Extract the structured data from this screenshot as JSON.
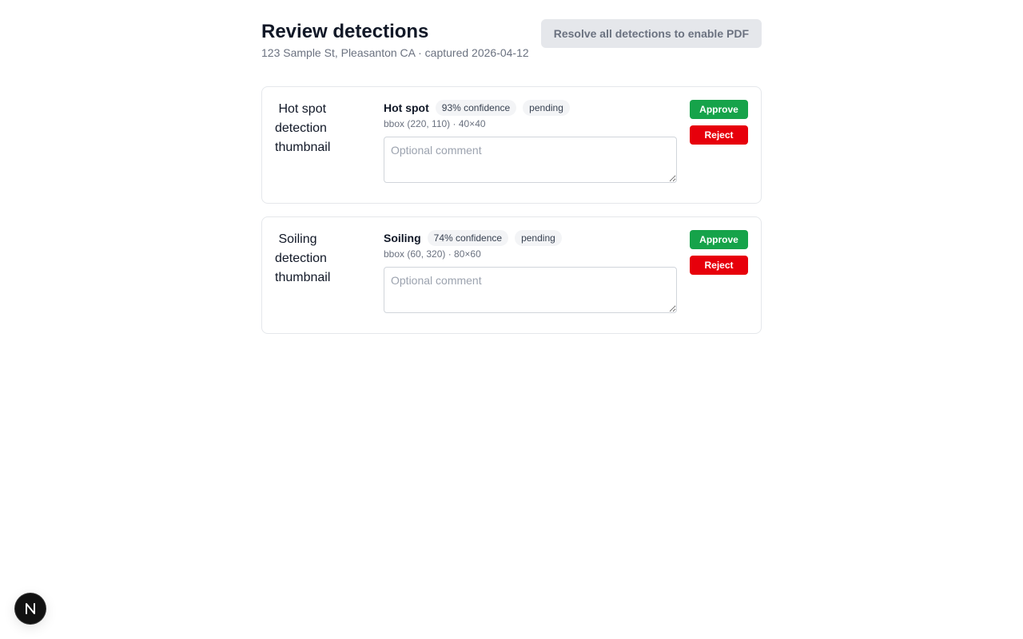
{
  "header": {
    "title": "Review detections",
    "subtitle": "123 Sample St, Pleasanton CA · captured 2026-04-12",
    "pdf_button_label": "Resolve all detections to enable PDF"
  },
  "detections": [
    {
      "thumbnail_alt": "Hot spot detection thumbnail",
      "label": "Hot spot",
      "confidence": "93% confidence",
      "status": "pending",
      "bbox": "bbox (220, 110) · 40×40",
      "comment_placeholder": "Optional comment",
      "approve_label": "Approve",
      "reject_label": "Reject"
    },
    {
      "thumbnail_alt": "Soiling detection thumbnail",
      "label": "Soiling",
      "confidence": "74% confidence",
      "status": "pending",
      "bbox": "bbox (60, 320) · 80×60",
      "comment_placeholder": "Optional comment",
      "approve_label": "Approve",
      "reject_label": "Reject"
    }
  ],
  "colors": {
    "approve": "#16a34a",
    "reject": "#e7000b",
    "disabled_button_bg": "#e5e7eb"
  },
  "icons": {
    "dev_badge": "nextjs-logo-icon",
    "thumbnail": "broken-image-icon"
  }
}
